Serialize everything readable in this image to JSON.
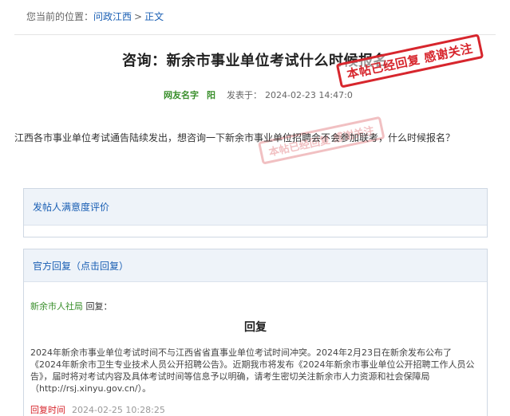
{
  "breadcrumb": {
    "prefix": "您当前的位置：",
    "items": [
      "问政江西",
      "正文"
    ],
    "separator": ">"
  },
  "post": {
    "title": "咨询：新余市事业单位考试什么时候报名",
    "user_name": "网友名字",
    "user_suffix": "阳",
    "posted_label": "发表于：",
    "posted_at": "2024-02-23 14:47:0",
    "question": "江西各市事业单位考试通告陆续发出，想咨询一下新余市事业单位招聘会不会参加联考，什么时候报名？",
    "stamp_text": "本帖已经回复 感谢关注",
    "stamp_ghost_text": "本帖已经回复 感谢关注"
  },
  "rating_panel": {
    "header": "发帖人满意度评价"
  },
  "reply_panel": {
    "header": "官方回复（点击回复）",
    "replier_name": "新余市人社局",
    "replier_suffix": "回复：",
    "heading": "回复",
    "text": "2024年新余市事业单位考试时间不与江西省省直事业单位考试时间冲突。2024年2月23日在新余发布公布了《2024年新余市卫生专业技术人员公开招聘公告》。近期我市将发布《2024年新余市事业单位公开招聘工作人员公告》，届时将对考试内容及具体考试时间等信息予以明确，请考生密切关注新余市人力资源和社会保障局（http://rsj.xinyu.gov.cn/）。",
    "time_label": "回复时间",
    "time_value": "2024-02-25 10:28:25"
  },
  "colors": {
    "link_blue": "#1a5fb4",
    "user_green": "#3a8f2c",
    "stamp_red": "#d7262d",
    "panel_header_bg": "#eef3f9"
  }
}
